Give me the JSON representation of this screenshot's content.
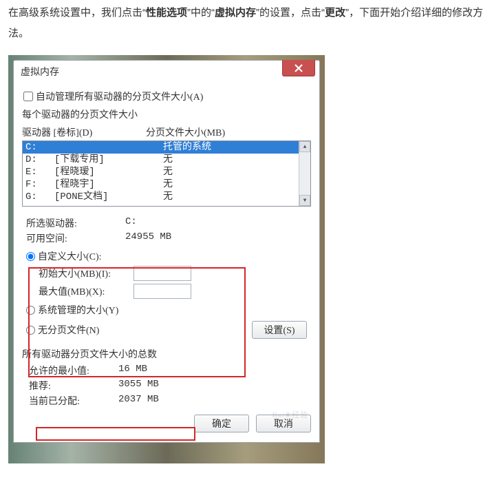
{
  "intro": {
    "p1a": "在高级系统设置中，我们点击“",
    "b1": "性能选项",
    "p1b": "”中的“",
    "b2": "虚拟内存",
    "p1c": "”的设置，点击“",
    "b3": "更改",
    "p1d": "”，下面开始介绍详细的修改方法。"
  },
  "dialog": {
    "title": "虚拟内存",
    "auto_manage": "自动管理所有驱动器的分页文件大小(A)",
    "each_drive_title": "每个驱动器的分页文件大小",
    "col_drive": "驱动器 [卷标](D)",
    "col_page": "分页文件大小(MB)",
    "drives": [
      {
        "label": "C:",
        "value": "托管的系统"
      },
      {
        "label": "D:   [下载专用]",
        "value": "无"
      },
      {
        "label": "E:   [程晓瑷]",
        "value": "无"
      },
      {
        "label": "F:   [程晓宇]",
        "value": "无"
      },
      {
        "label": "G:   [PONE文档]",
        "value": "无"
      }
    ],
    "selected_drive_label": "所选驱动器:",
    "selected_drive_value": "C:",
    "free_space_label": "可用空间:",
    "free_space_value": "24955 MB",
    "custom_size": "自定义大小(C):",
    "initial_label": "初始大小(MB)(I):",
    "initial_value": "",
    "max_label": "最大值(MB)(X):",
    "max_value": "",
    "system_managed": "系统管理的大小(Y)",
    "no_paging": "无分页文件(N)",
    "set_btn": "设置(S)",
    "totals_title": "所有驱动器分页文件大小的总数",
    "min_label": "允许的最小值:",
    "min_value": "16 MB",
    "rec_label": "推荐:",
    "rec_value": "3055 MB",
    "cur_label": "当前已分配:",
    "cur_value": "2037 MB",
    "ok": "确定",
    "cancel": "取消",
    "watermark": "Bai❀经验"
  }
}
